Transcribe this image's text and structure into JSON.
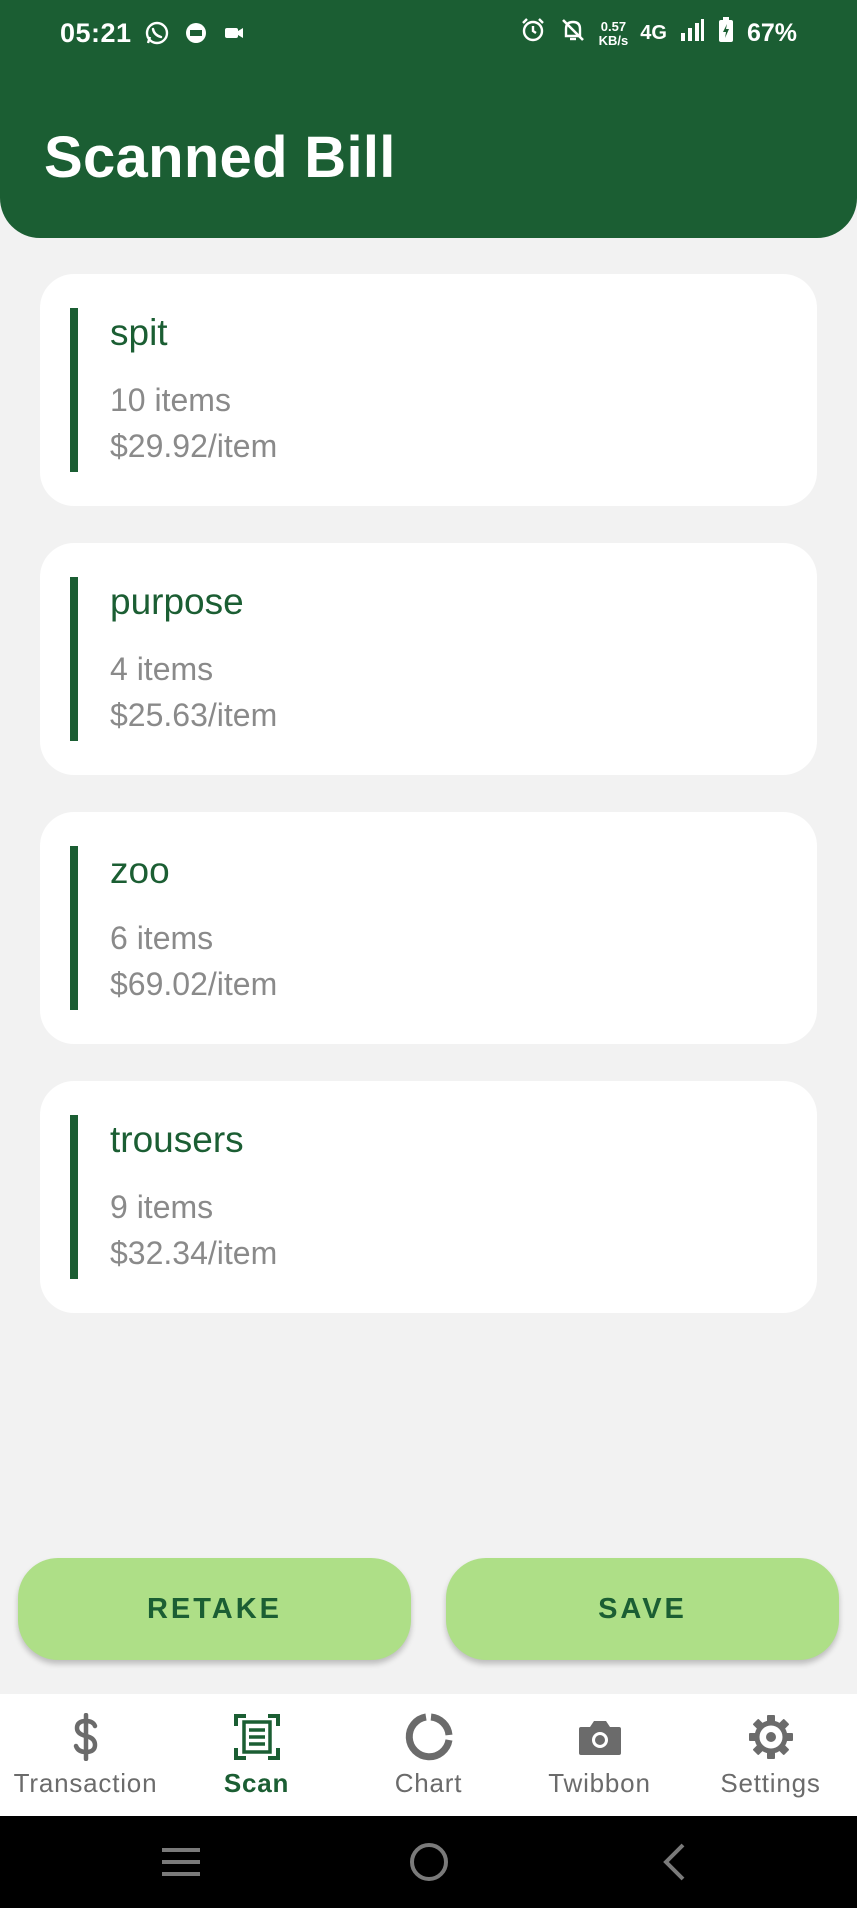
{
  "status_bar": {
    "time": "05:21",
    "net_speed_value": "0.57",
    "net_speed_unit": "KB/s",
    "network": "4G",
    "battery": "67%"
  },
  "header": {
    "title": "Scanned Bill"
  },
  "items": [
    {
      "name": "spit",
      "quantity": "10 items",
      "price": "$29.92/item"
    },
    {
      "name": "purpose",
      "quantity": "4 items",
      "price": "$25.63/item"
    },
    {
      "name": "zoo",
      "quantity": "6 items",
      "price": "$69.02/item"
    },
    {
      "name": "trousers",
      "quantity": "9 items",
      "price": "$32.34/item"
    }
  ],
  "actions": {
    "retake_label": "RETAKE",
    "save_label": "SAVE"
  },
  "bottom_nav": [
    {
      "label": "Transaction",
      "icon": "dollar-icon",
      "active": false
    },
    {
      "label": "Scan",
      "icon": "scan-document-icon",
      "active": true
    },
    {
      "label": "Chart",
      "icon": "donut-chart-icon",
      "active": false
    },
    {
      "label": "Twibbon",
      "icon": "camera-icon",
      "active": false
    },
    {
      "label": "Settings",
      "icon": "gear-icon",
      "active": false
    }
  ],
  "colors": {
    "primary": "#1b5e33",
    "accent_button": "#aedf87",
    "background": "#f2f2f2",
    "muted_text": "#8a8a8a"
  }
}
